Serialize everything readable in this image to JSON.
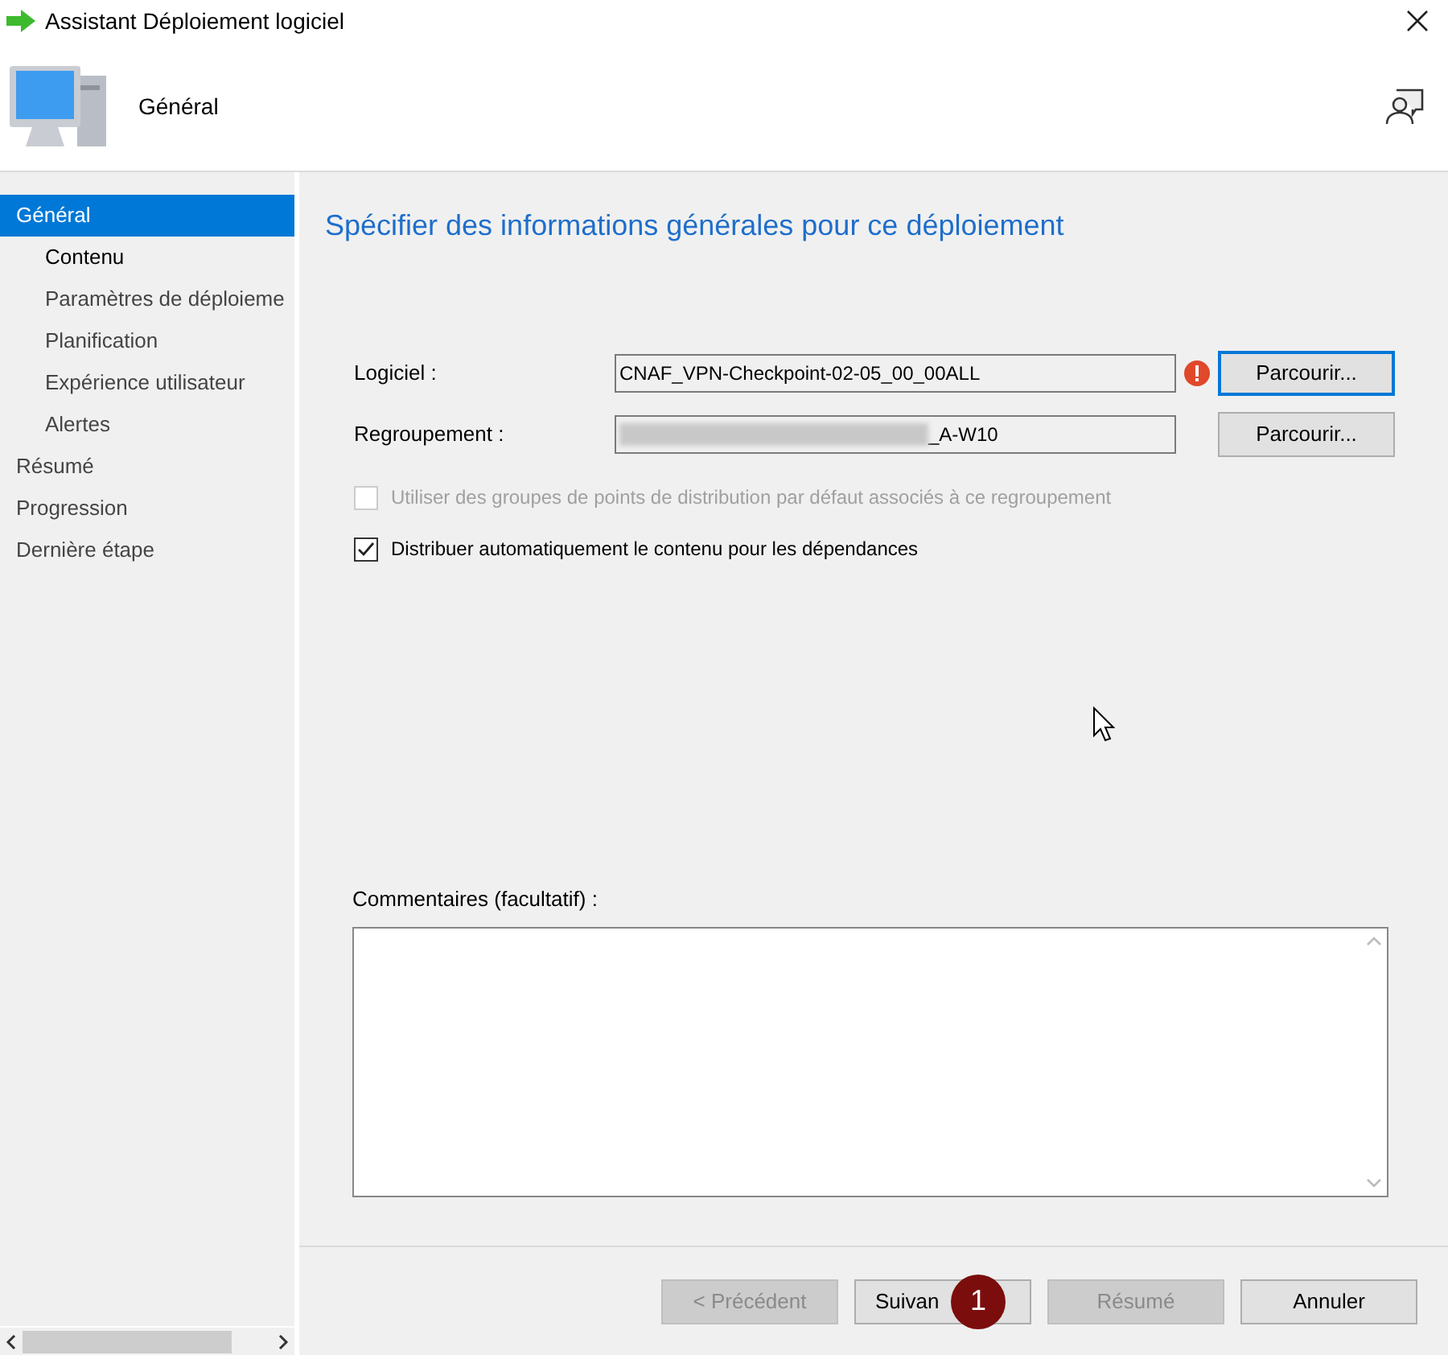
{
  "window": {
    "title": "Assistant Déploiement logiciel"
  },
  "header": {
    "title": "Général"
  },
  "sidebar": {
    "items": [
      {
        "label": "Général",
        "selected": true,
        "current": false,
        "children": [
          {
            "label": "Contenu",
            "selected": false,
            "current": true
          },
          {
            "label": "Paramètres de déploieme",
            "selected": false,
            "current": false
          },
          {
            "label": "Planification",
            "selected": false,
            "current": false
          },
          {
            "label": "Expérience utilisateur",
            "selected": false,
            "current": false
          },
          {
            "label": "Alertes",
            "selected": false,
            "current": false
          }
        ]
      },
      {
        "label": "Résumé",
        "selected": false,
        "current": false
      },
      {
        "label": "Progression",
        "selected": false,
        "current": false
      },
      {
        "label": "Dernière étape",
        "selected": false,
        "current": false
      }
    ]
  },
  "main": {
    "heading": "Spécifier des informations générales pour ce déploiement",
    "fields": [
      {
        "label": "Logiciel :",
        "value": "CNAF_VPN-Checkpoint-02-05_00_00ALL",
        "redacted": false,
        "error": true,
        "button": {
          "label": "Parcourir...",
          "focused": true
        }
      },
      {
        "label": "Regroupement :",
        "value": "_A-W10",
        "redacted": true,
        "error": false,
        "button": {
          "label": "Parcourir...",
          "focused": false
        }
      }
    ],
    "checkboxes": [
      {
        "label": "Utiliser des groupes de points de distribution par défaut associés à ce regroupement",
        "checked": false,
        "disabled": true
      },
      {
        "label": "Distribuer automatiquement le contenu pour les dépendances",
        "checked": true,
        "disabled": false
      }
    ],
    "comments": {
      "label": "Commentaires (facultatif) :"
    }
  },
  "footer": {
    "buttons": [
      {
        "label": "< Précédent",
        "disabled": true
      },
      {
        "label": "Suivan",
        "disabled": false,
        "badge": "1"
      },
      {
        "label": "Résumé",
        "disabled": true
      },
      {
        "label": "Annuler",
        "disabled": false
      }
    ]
  }
}
